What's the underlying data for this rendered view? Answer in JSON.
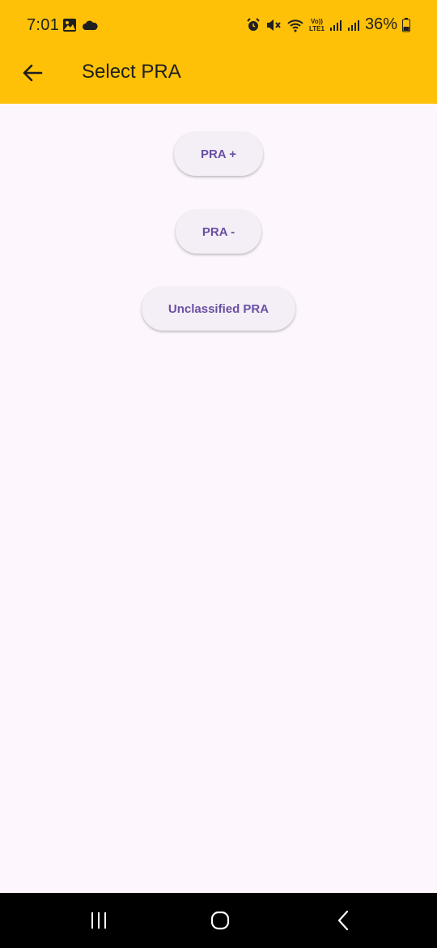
{
  "status_bar": {
    "time": "7:01",
    "battery_percent": "36%",
    "network_label_top": "Vo))",
    "network_label_bottom": "LTE1",
    "left_icons": [
      "image-icon",
      "cloud-icon"
    ],
    "right_icons": [
      "alarm-icon",
      "mute-icon",
      "wifi-icon",
      "signal-icon",
      "signal-icon",
      "battery-icon"
    ]
  },
  "app_bar": {
    "title": "Select PRA",
    "background": "#ffc107"
  },
  "options": [
    {
      "label": "PRA +"
    },
    {
      "label": "PRA -"
    },
    {
      "label": "Unclassified PRA"
    }
  ],
  "colors": {
    "accent_text": "#6a4fa3",
    "page_background": "#fdf7fd",
    "button_background": "#f4eff6"
  },
  "nav_bar": {
    "buttons": [
      "recents-icon",
      "home-icon",
      "back-icon"
    ]
  }
}
